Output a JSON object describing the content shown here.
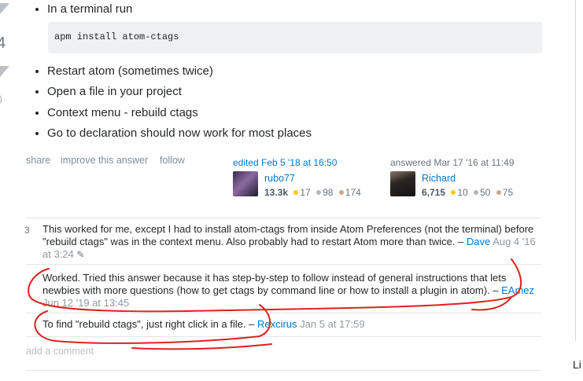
{
  "vote": {
    "count": "4",
    "second_count": "0"
  },
  "steps": [
    "In a terminal run",
    "Restart atom (sometimes twice)",
    "Open a file in your project",
    "Context menu - rebuild ctags",
    "Go to declaration should now work for most places"
  ],
  "code": "apm install atom-ctags",
  "post_menu": {
    "share": "share",
    "improve": "improve this answer",
    "follow": "follow"
  },
  "editor": {
    "action": "edited Feb 5 '18 at 16:50",
    "name": "rubo77",
    "rep": "13.3k",
    "gold": "17",
    "silver": "98",
    "bronze": "174"
  },
  "answerer": {
    "action": "answered Mar 17 '16 at 11:49",
    "name": "Richard",
    "rep": "6,715",
    "gold": "10",
    "silver": "50",
    "bronze": "75"
  },
  "comments": [
    {
      "score": "3",
      "text": "This worked for me, except I had to install atom-ctags from inside Atom Preferences (not the terminal) before \"rebuild ctags\" was in the context menu. Also probably had to restart Atom more than twice. –",
      "user": "Dave",
      "date": "Aug 4 '16 at 3:24"
    },
    {
      "score": "",
      "text": "Worked. Tried this answer because it has step-by-step to follow instead of general instructions that lets newbies with more questions (how to get ctags by command line or how to install a plugin in atom). –",
      "user": "EAmez",
      "date": "Jun 12 '19 at 13:45"
    },
    {
      "score": "",
      "text": "To find \"rebuild ctags\", just right click in a file. –",
      "user": "Rexcirus",
      "date": "Jan 5 at 17:59"
    }
  ],
  "add_comment": "add a comment",
  "sidebar_text": "Li",
  "colors": {
    "link": "#0077cc",
    "gold": "#ffcc01",
    "silver": "#b4b8bc",
    "bronze": "#d1a684",
    "annotation": "#e02020"
  }
}
